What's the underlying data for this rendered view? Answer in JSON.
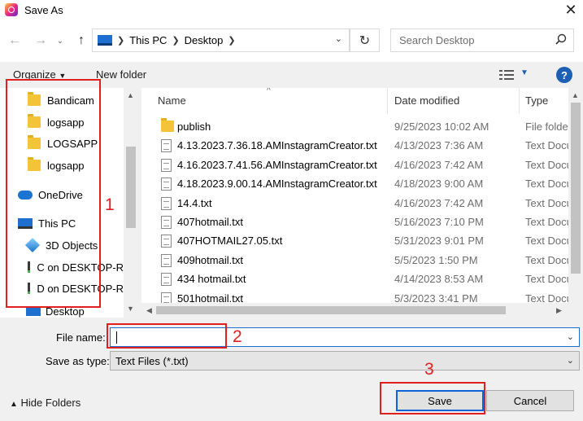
{
  "title": "Save As",
  "address": {
    "crumbs": [
      "This PC",
      "Desktop"
    ]
  },
  "search": {
    "placeholder": "Search Desktop"
  },
  "toolbar": {
    "organize": "Organize",
    "new_folder": "New folder",
    "help": "?"
  },
  "nav": {
    "items": [
      {
        "label": "Bandicam",
        "icon": "folder-icon"
      },
      {
        "label": "logsapp",
        "icon": "folder-icon"
      },
      {
        "label": "LOGSAPP",
        "icon": "folder-icon"
      },
      {
        "label": "logsapp",
        "icon": "folder-icon"
      },
      {
        "label": "OneDrive",
        "icon": "cloud-icon"
      },
      {
        "label": "This PC",
        "icon": "computer-icon"
      },
      {
        "label": "3D Objects",
        "icon": "cube-icon"
      },
      {
        "label": "C on DESKTOP-R",
        "icon": "network-drive-icon"
      },
      {
        "label": "D on DESKTOP-R",
        "icon": "network-drive-icon"
      },
      {
        "label": "Desktop",
        "icon": "desktop-icon"
      }
    ]
  },
  "files": {
    "columns": [
      "Name",
      "Date modified",
      "Type"
    ],
    "rows": [
      {
        "name": "publish",
        "date": "9/25/2023 10:02 AM",
        "type": "File folde",
        "kind": "folder"
      },
      {
        "name": "4.13.2023.7.36.18.AMInstagramCreator.txt",
        "date": "4/13/2023 7:36 AM",
        "type": "Text Docu",
        "kind": "txt"
      },
      {
        "name": "4.16.2023.7.41.56.AMInstagramCreator.txt",
        "date": "4/16/2023 7:42 AM",
        "type": "Text Docu",
        "kind": "txt"
      },
      {
        "name": "4.18.2023.9.00.14.AMInstagramCreator.txt",
        "date": "4/18/2023 9:00 AM",
        "type": "Text Docu",
        "kind": "txt"
      },
      {
        "name": "14.4.txt",
        "date": "4/16/2023 7:42 AM",
        "type": "Text Docu",
        "kind": "txt"
      },
      {
        "name": "407hotmail.txt",
        "date": "5/16/2023 7:10 PM",
        "type": "Text Docu",
        "kind": "txt"
      },
      {
        "name": "407HOTMAIL27.05.txt",
        "date": "5/31/2023 9:01 PM",
        "type": "Text Docu",
        "kind": "txt"
      },
      {
        "name": "409hotmail.txt",
        "date": "5/5/2023 1:50 PM",
        "type": "Text Docu",
        "kind": "txt"
      },
      {
        "name": "434 hotmail.txt",
        "date": "4/14/2023 8:53 AM",
        "type": "Text Docu",
        "kind": "txt"
      },
      {
        "name": "501hotmail.txt",
        "date": "5/3/2023 3:41 PM",
        "type": "Text Docu",
        "kind": "txt"
      }
    ]
  },
  "form": {
    "file_name_label": "File name:",
    "file_name_value": "",
    "save_type_label": "Save as type:",
    "save_type_value": "Text Files (*.txt)"
  },
  "footer": {
    "hide_folders": "Hide Folders",
    "save": "Save",
    "cancel": "Cancel"
  },
  "annotations": [
    "1",
    "2",
    "3"
  ],
  "colors": {
    "annotation": "#e02020",
    "accent": "#1c6dd0"
  }
}
